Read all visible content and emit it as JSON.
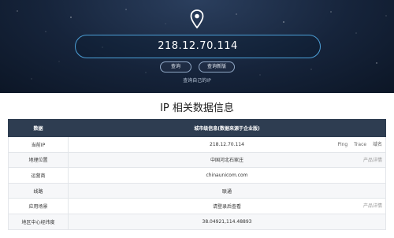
{
  "hero": {
    "ip": "218.12.70.114",
    "buttons": {
      "query": "查询",
      "refresh": "查询新版"
    },
    "hint": "查询自己的IP"
  },
  "section": {
    "title": "IP 相关数据信息"
  },
  "table": {
    "headers": {
      "col1": "数据",
      "col2": "城市级信息(数据来源于企业版)"
    },
    "rows": [
      {
        "label": "当前IP",
        "value": "218.12.70.114",
        "links": [
          "Ping",
          "Trace",
          "域名"
        ]
      },
      {
        "label": "地理位置",
        "value": "中国河北石家庄",
        "detail": "产品详情"
      },
      {
        "label": "运营商",
        "value": "chinaunicom.com"
      },
      {
        "label": "线路",
        "value": "联通"
      },
      {
        "label": "应用场景",
        "value": "请登录后查看",
        "detail": "产品详情"
      },
      {
        "label": "地区中心经纬度",
        "value": "38.04921,114.48893"
      }
    ]
  },
  "colors": {
    "hero_bg": "#16243b",
    "search_border": "#4c9fd6",
    "table_header": "#2e3d51"
  },
  "icons": {
    "pin": "location-pin-icon"
  }
}
